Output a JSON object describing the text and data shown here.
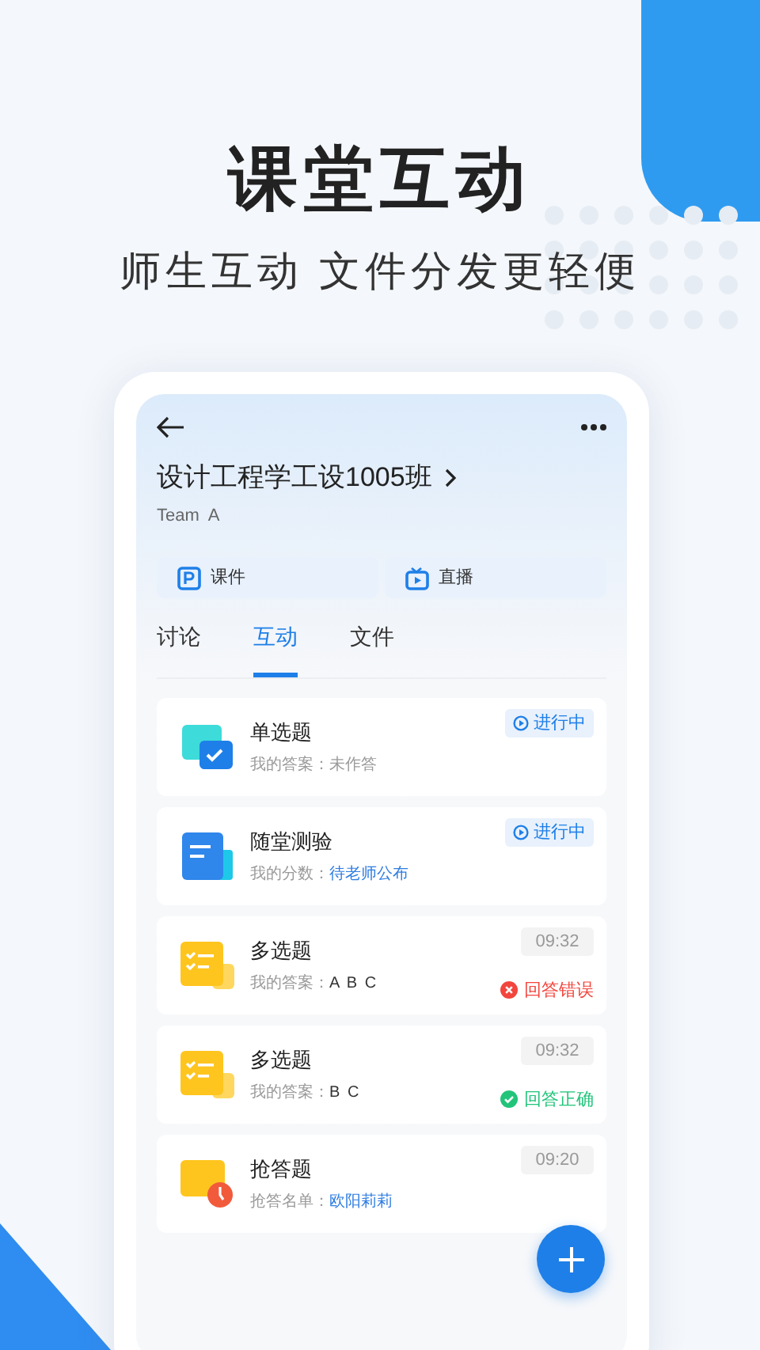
{
  "headline": "课堂互动",
  "subheadline": "师生互动 文件分发更轻便",
  "class": {
    "name": "设计工程学工设1005班",
    "team": "Team  A"
  },
  "shortcuts": [
    {
      "kind": "slides",
      "label": "课件"
    },
    {
      "kind": "live",
      "label": "直播"
    }
  ],
  "tabs": [
    {
      "label": "讨论",
      "selected": false
    },
    {
      "label": "互动",
      "selected": true
    },
    {
      "label": "文件",
      "selected": false
    }
  ],
  "items": [
    {
      "kind": "single",
      "title": "单选题",
      "answer_label": "我的答案：",
      "answer": {
        "kind": "muted",
        "text": "未作答"
      },
      "status": {
        "kind": "ongoing",
        "text": "进行中"
      }
    },
    {
      "kind": "quiz",
      "title": "随堂测验",
      "answer_label": "我的分数：",
      "answer": {
        "kind": "link",
        "text": "待老师公布"
      },
      "status": {
        "kind": "ongoing",
        "text": "进行中"
      }
    },
    {
      "kind": "multi",
      "title": "多选题",
      "answer_label": "我的答案：",
      "answer": {
        "kind": "plain",
        "text": "A B C"
      },
      "time": "09:32",
      "result": {
        "kind": "wrong",
        "text": "回答错误"
      }
    },
    {
      "kind": "multi",
      "title": "多选题",
      "answer_label": "我的答案：",
      "answer": {
        "kind": "plain",
        "text": "B C"
      },
      "time": "09:32",
      "result": {
        "kind": "right",
        "text": "回答正确"
      }
    },
    {
      "kind": "rush",
      "title": "抢答题",
      "answer_label": "抢答名单：",
      "answer": {
        "kind": "link",
        "text": "欧阳莉莉"
      },
      "time": "09:20"
    }
  ]
}
